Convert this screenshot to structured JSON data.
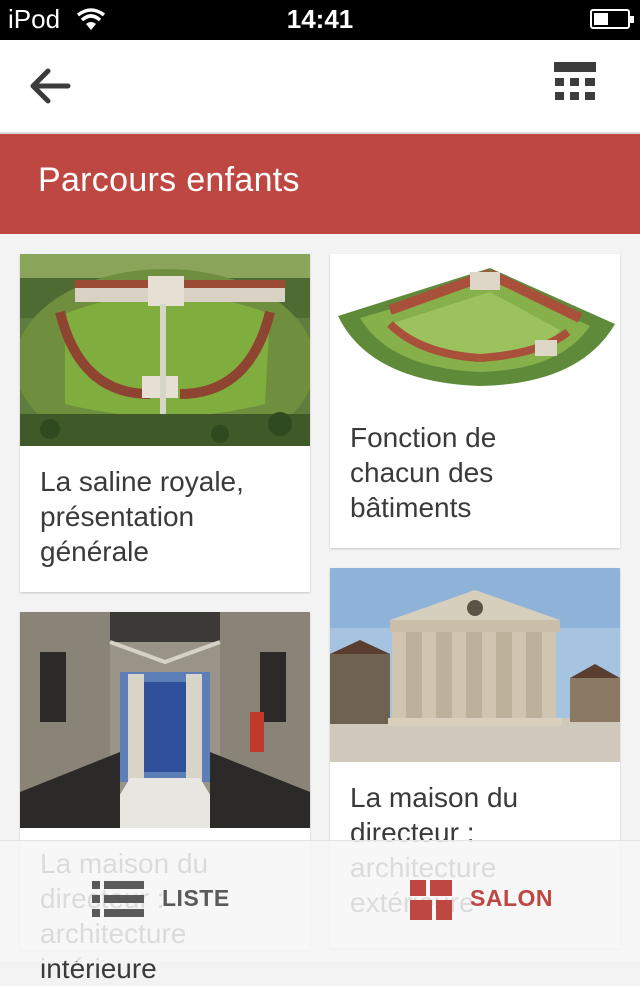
{
  "status_bar": {
    "carrier": "iPod",
    "time": "14:41"
  },
  "header": {
    "back_icon": "arrow-left-icon",
    "view_icon": "grid-view-icon"
  },
  "title_band": {
    "title": "Parcours enfants",
    "color": "#bf4741"
  },
  "cards": [
    {
      "caption": "La saline royale,\nprésentation\ngénérale",
      "image": "aerial-view-saline-photo"
    },
    {
      "caption": "Fonction de\nchacun des\nbâtiments",
      "image": "3d-model-saline-image"
    },
    {
      "caption": "La maison du\ndirecteur :\narchitecture\nintérieure",
      "image": "interior-staircase-photo"
    },
    {
      "caption": "La maison du\ndirecteur :\narchitecture\nextérieure",
      "image": "director-house-facade-photo"
    }
  ],
  "tabbar": {
    "tabs": [
      {
        "label": "LISTE",
        "icon": "list-icon",
        "active": false
      },
      {
        "label": "SALON",
        "icon": "mosaic-icon",
        "active": true
      }
    ],
    "active_color": "#bf4741",
    "inactive_color": "#5a5a5a"
  }
}
